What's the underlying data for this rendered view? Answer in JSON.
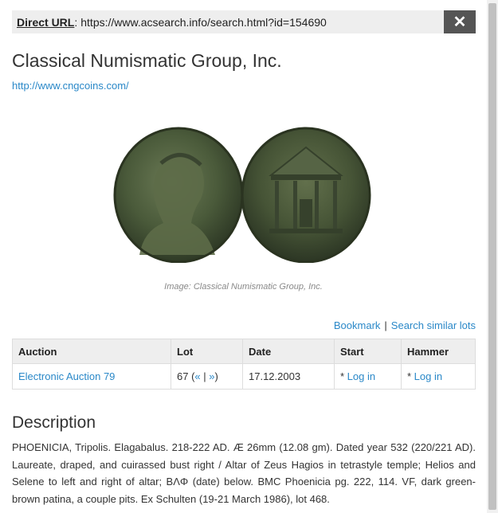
{
  "url_bar": {
    "label": "Direct URL",
    "colon": ":",
    "value": "https://www.acsearch.info/search.html?id=154690",
    "close_glyph": "✕"
  },
  "company": {
    "name": "Classical Numismatic Group, Inc.",
    "website": "http://www.cngcoins.com/"
  },
  "image": {
    "caption": "Image: Classical Numismatic Group, Inc."
  },
  "actions": {
    "bookmark": "Bookmark",
    "separator": "|",
    "search_similar": "Search similar lots"
  },
  "table": {
    "headers": [
      "Auction",
      "Lot",
      "Date",
      "Start",
      "Hammer"
    ],
    "row": {
      "auction": "Electronic Auction 79",
      "lot_number": "67 (",
      "lot_prev": "«",
      "lot_sep": " | ",
      "lot_next": "»",
      "lot_close": ")",
      "date": "17.12.2003",
      "start_prefix": "* ",
      "start_link": "Log in",
      "hammer_prefix": "* ",
      "hammer_link": "Log in"
    }
  },
  "description": {
    "title": "Description",
    "text": "PHOENICIA, Tripolis. Elagabalus. 218-222 AD. Æ 26mm (12.08 gm). Dated year 532 (220/221 AD). Laureate, draped, and cuirassed bust right / Altar of Zeus Hagios in tetrastyle temple; Helios and Selene to left and right of altar; ΒΛΦ (date) below. BMC Phoenicia pg. 222, 114. VF, dark green-brown patina, a couple pits. Ex Schulten (19-21 March 1986), lot 468."
  },
  "colors": {
    "link": "#2a88c8",
    "close_button": "#555555",
    "header_bg": "#eeeeee",
    "coin_patina": "#4a5a3a"
  }
}
